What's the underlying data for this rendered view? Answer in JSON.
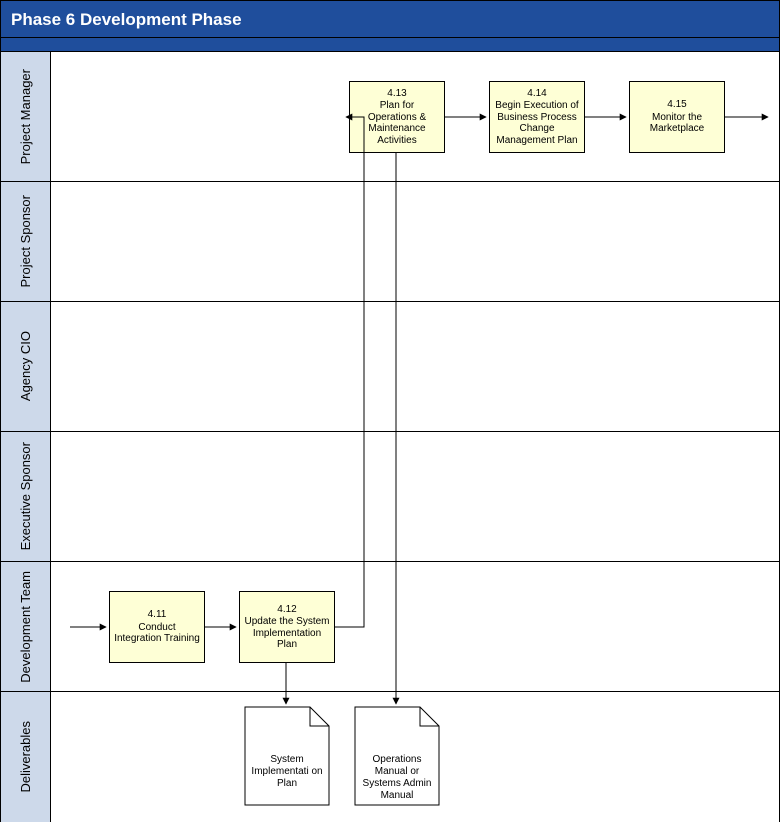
{
  "header": {
    "title": "Phase 6 Development Phase"
  },
  "lanes": {
    "pm_label": "Project\nManager",
    "ps_label": "Project\nSponsor",
    "cio_label": "Agency\nCIO",
    "es_label": "Executive\nSponsor",
    "dev_label": "Development\nTeam",
    "del_label": "Deliverables"
  },
  "activities": {
    "a411": {
      "num": "4.11",
      "text": "Conduct Integration Training"
    },
    "a412": {
      "num": "4.12",
      "text": "Update the System Implementation Plan"
    },
    "a413": {
      "num": "4.13",
      "text": "Plan for Operations & Maintenance Activities"
    },
    "a414": {
      "num": "4.14",
      "text": "Begin Execution of Business Process Change Management Plan"
    },
    "a415": {
      "num": "4.15",
      "text": "Monitor the Marketplace"
    }
  },
  "documents": {
    "d1": "System Implementati on Plan",
    "d2": "Operations Manual or Systems Admin Manual"
  },
  "colors": {
    "header_bg": "#1f4e9c",
    "lane_label_bg": "#cdd9ea",
    "activity_bg": "#feffd6"
  }
}
